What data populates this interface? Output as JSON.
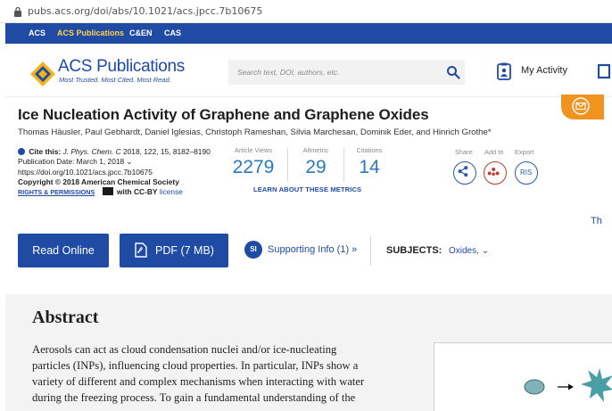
{
  "browser": {
    "url": "pubs.acs.org/doi/abs/10.1021/acs.jpcc.7b10675"
  },
  "topnav": {
    "items": [
      "ACS",
      "ACS Publications",
      "C&EN",
      "CAS"
    ]
  },
  "header": {
    "logo_text": "ACS Publications",
    "tagline": "Most Trusted. Most Cited. Most Read.",
    "search_placeholder": "Search text, DOI, authors, etc.",
    "my_activity": "My Activity"
  },
  "article": {
    "title": "Ice Nucleation Activity of Graphene and Graphene Oxides",
    "authors": "Thomas Häusler, Paul Gebhardt, Daniel Iglesias, Christoph Rameshan, Silvia Marchesan, Dominik Eder, and Hinrich Grothe*",
    "cite_label": "Cite this:",
    "journal": "J. Phys. Chem. C",
    "citation": "2018, 122, 15, 8182–8190",
    "pub_date": "Publication Date: March 1, 2018",
    "doi": "https://doi.org/10.1021/acs.jpcc.7b10675",
    "copyright": "Copyright © 2018 American Chemical Society",
    "rights": "RIGHTS & PERMISSIONS",
    "license_prefix": "with CC-BY",
    "license": "license"
  },
  "metrics": {
    "views_label": "Article Views",
    "views": "2279",
    "altmetric_label": "Altmetric",
    "altmetric": "29",
    "citations_label": "Citations",
    "citations": "14",
    "learn": "LEARN ABOUT THESE METRICS"
  },
  "share": {
    "share_label": "Share",
    "add_label": "Add to",
    "export_label": "Export",
    "ris": "RIS"
  },
  "side_cut": "Th",
  "actions": {
    "read_online": "Read Online",
    "pdf": "PDF (7 MB)",
    "si_badge": "SI",
    "supporting": "Supporting Info (1) »",
    "subjects_label": "SUBJECTS:",
    "subjects_value": "Oxides,"
  },
  "abstract": {
    "heading": "Abstract",
    "lines": [
      "Aerosols can act as cloud condensation nuclei and/or ice-nucleating",
      "particles (INPs), influencing cloud properties. In particular, INPs show a",
      "variety of different and complex mechanisms when interacting with water",
      "during the freezing process. To gain a fundamental understanding of the"
    ]
  },
  "colors": {
    "brand_blue": "#1f4ba5",
    "accent_orange": "#f0931f",
    "metric_blue": "#2a78c2"
  }
}
